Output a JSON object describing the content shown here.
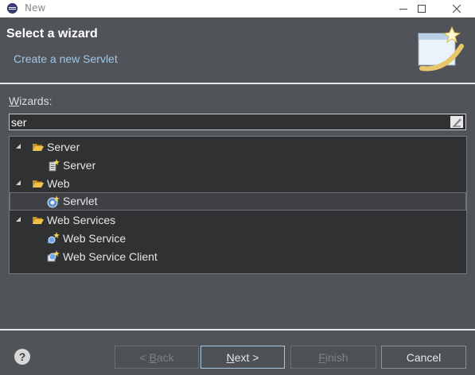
{
  "window": {
    "title": "New"
  },
  "header": {
    "title": "Select a wizard",
    "description": "Create a new Servlet"
  },
  "filter": {
    "label_mnemonic": "W",
    "label_rest": "izards:",
    "value": "ser"
  },
  "tree": [
    {
      "label": "Server",
      "kind": "category",
      "icon": "folder-open-icon"
    },
    {
      "label": "Server",
      "kind": "item",
      "icon": "server-wizard-icon"
    },
    {
      "label": "Web",
      "kind": "category",
      "icon": "folder-open-icon"
    },
    {
      "label": "Servlet",
      "kind": "item",
      "icon": "servlet-icon",
      "selected": true
    },
    {
      "label": "Web Services",
      "kind": "category",
      "icon": "folder-open-icon"
    },
    {
      "label": "Web Service",
      "kind": "item",
      "icon": "web-service-icon"
    },
    {
      "label": "Web Service Client",
      "kind": "item",
      "icon": "web-service-client-icon"
    }
  ],
  "buttons": {
    "back": {
      "prefix": "< ",
      "mnemonic": "B",
      "rest": "ack",
      "enabled": false
    },
    "next": {
      "mnemonic": "N",
      "rest": "ext >",
      "enabled": true
    },
    "finish": {
      "mnemonic": "F",
      "rest": "inish",
      "enabled": false
    },
    "cancel": {
      "label": "Cancel",
      "enabled": true
    }
  },
  "colors": {
    "dialog_bg": "#505357",
    "tree_bg": "#2f3133",
    "description_text": "#9fc7e6",
    "folder": "#e8b23a"
  }
}
